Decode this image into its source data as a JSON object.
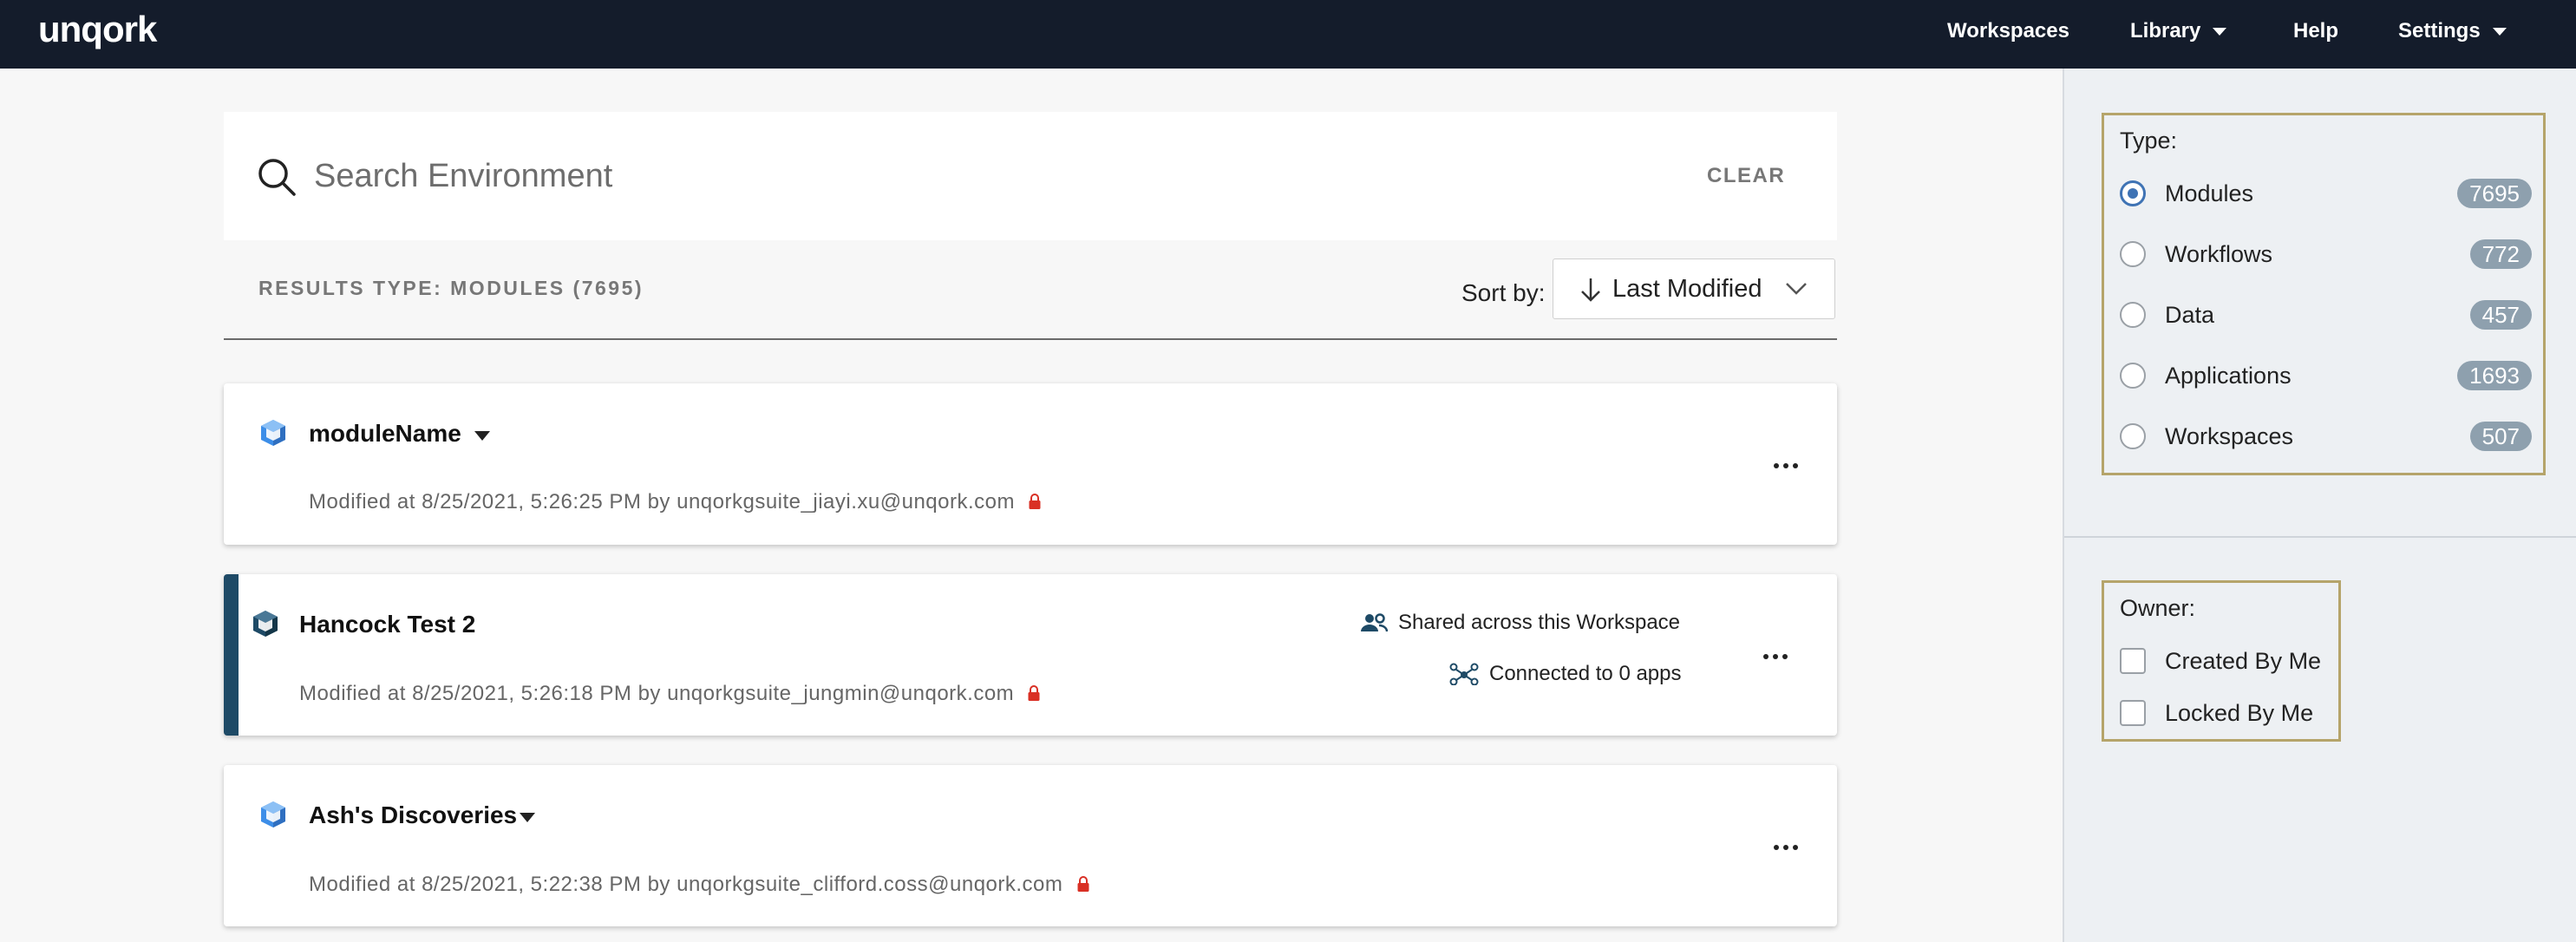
{
  "nav": {
    "logo": "unqork",
    "items": [
      {
        "label": "Workspaces"
      },
      {
        "label": "Library"
      },
      {
        "label": "Help"
      },
      {
        "label": "Settings"
      }
    ]
  },
  "search": {
    "placeholder": "Search Environment",
    "clear_label": "CLEAR"
  },
  "results": {
    "type_label": "RESULTS TYPE: MODULES (7695)",
    "sort_label": "Sort by:",
    "sort_value": "Last Modified"
  },
  "cards": [
    {
      "title": "moduleName",
      "meta": "Modified at 8/25/2021, 5:26:25 PM by unqorkgsuite_jiayi.xu@unqork.com"
    },
    {
      "title": "Hancock Test 2",
      "meta": "Modified at 8/25/2021, 5:26:18 PM by unqorkgsuite_jungmin@unqork.com",
      "shared": "Shared across this Workspace",
      "connected": "Connected to 0 apps"
    },
    {
      "title": "Ash's Discoveries",
      "meta": "Modified at 8/25/2021, 5:22:38 PM by unqorkgsuite_clifford.coss@unqork.com"
    }
  ],
  "filters": {
    "type_label": "Type:",
    "types": [
      {
        "name": "Modules",
        "count": "7695",
        "selected": true
      },
      {
        "name": "Workflows",
        "count": "772"
      },
      {
        "name": "Data",
        "count": "457"
      },
      {
        "name": "Applications",
        "count": "1693"
      },
      {
        "name": "Workspaces",
        "count": "507"
      }
    ],
    "owner_label": "Owner:",
    "owners": [
      {
        "name": "Created By Me"
      },
      {
        "name": "Locked By Me"
      }
    ]
  },
  "colors": {
    "nav_bg": "#141c2b",
    "accent": "#3f73b4",
    "badge": "#8ea0ae",
    "lock": "#d93025",
    "filter_border": "#b5a46a"
  }
}
